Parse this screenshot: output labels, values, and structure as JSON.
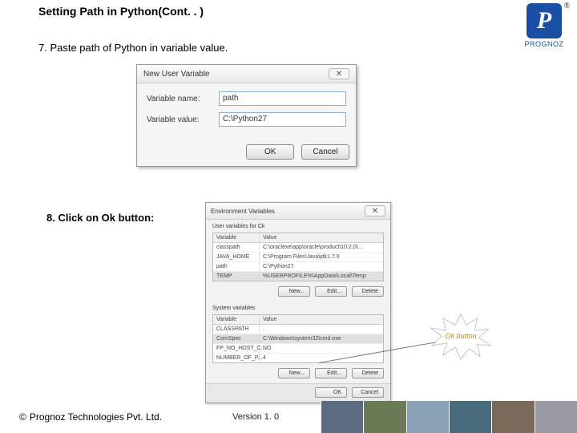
{
  "slide": {
    "title": "Setting Path in Python(Cont. . )",
    "step7": "7. Paste path of Python in variable value.",
    "step8": "8. Click on Ok button:"
  },
  "logo": {
    "glyph": "P",
    "registered": "®",
    "name": "PROGNOZ"
  },
  "dialog1": {
    "title": "New User Variable",
    "label_name": "Variable name:",
    "label_value": "Variable value:",
    "value_name": "path",
    "value_value": "C:\\Python27",
    "ok": "OK",
    "cancel": "Cancel"
  },
  "dialog2": {
    "title": "Environment Variables",
    "user_section": "User variables for Ck",
    "system_section": "System variables",
    "col_var": "Variable",
    "col_val": "Value",
    "user_rows": [
      {
        "var": "classpath",
        "val": "C:\\oraclexe\\app\\oracle\\product\\10.2.0\\..."
      },
      {
        "var": "JAVA_HOME",
        "val": "C:\\Program Files\\Java\\jdk1.7.0"
      },
      {
        "var": "path",
        "val": "C:\\Python27"
      },
      {
        "var": "TEMP",
        "val": "%USERPROFILE%\\AppData\\Local\\Temp"
      }
    ],
    "sys_rows": [
      {
        "var": "CLASSPATH",
        "val": "."
      },
      {
        "var": "ComSpec",
        "val": "C:\\Windows\\system32\\cmd.exe"
      },
      {
        "var": "FP_NO_HOST_C...",
        "val": "NO"
      },
      {
        "var": "NUMBER_OF_P...",
        "val": "4"
      }
    ],
    "btn_new": "New...",
    "btn_edit": "Edit...",
    "btn_delete": "Delete",
    "btn_ok": "OK",
    "btn_cancel": "Cancel"
  },
  "callout": {
    "label": "Ok button"
  },
  "footer": {
    "copyright_symbol": "©",
    "company": "Prognoz Technologies Pvt. Ltd.",
    "version": "Version 1. 0"
  }
}
